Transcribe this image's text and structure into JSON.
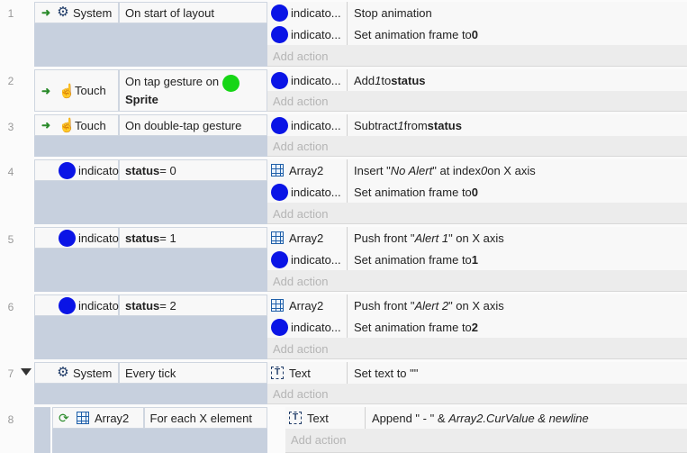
{
  "add_action_label": "Add action",
  "events": [
    {
      "number": "1",
      "condition": {
        "object": "System",
        "text": "On start of layout"
      },
      "actions": [
        {
          "object": "indicato...",
          "pre": "Stop animation",
          "em": "",
          "mid": "",
          "strong": ""
        },
        {
          "object": "indicato...",
          "pre": "Set animation frame to ",
          "em": "",
          "mid": "",
          "strong": "0"
        }
      ]
    },
    {
      "number": "2",
      "condition": {
        "object": "Touch",
        "text": "On tap gesture on",
        "text2": "Sprite"
      },
      "actions": [
        {
          "object": "indicato...",
          "pre": "Add ",
          "em": "1",
          "mid": " to ",
          "strong": "status"
        }
      ]
    },
    {
      "number": "3",
      "condition": {
        "object": "Touch",
        "text": "On double-tap gesture"
      },
      "actions": [
        {
          "object": "indicato...",
          "pre": "Subtract ",
          "em": "1",
          "mid": " from ",
          "strong": "status"
        }
      ]
    },
    {
      "number": "4",
      "condition": {
        "object": "indicator...",
        "strong": "status",
        "text": " = 0"
      },
      "actions": [
        {
          "object": "Array2",
          "pre": "Insert \"",
          "em": "No Alert",
          "mid": "\" at index ",
          "em2": "0",
          "post": " on X axis",
          "strong": ""
        },
        {
          "object": "indicato...",
          "pre": "Set animation frame to ",
          "em": "",
          "mid": "",
          "strong": "0"
        }
      ]
    },
    {
      "number": "5",
      "condition": {
        "object": "indicator...",
        "strong": "status",
        "text": " = 1"
      },
      "actions": [
        {
          "object": "Array2",
          "pre": "Push front \"",
          "em": "Alert 1",
          "mid": "\" on X axis",
          "strong": ""
        },
        {
          "object": "indicato...",
          "pre": "Set animation frame to ",
          "em": "",
          "mid": "",
          "strong": "1"
        }
      ]
    },
    {
      "number": "6",
      "condition": {
        "object": "indicator...",
        "strong": "status",
        "text": " = 2"
      },
      "actions": [
        {
          "object": "Array2",
          "pre": "Push front \"",
          "em": "Alert 2",
          "mid": "\" on X axis",
          "strong": ""
        },
        {
          "object": "indicato...",
          "pre": "Set animation frame to ",
          "em": "",
          "mid": "",
          "strong": "2"
        }
      ]
    },
    {
      "number": "7",
      "condition": {
        "object": "System",
        "text": "Every tick"
      },
      "actions": [
        {
          "object": "Text",
          "pre": "Set text to \"\"",
          "em": "",
          "mid": "",
          "strong": ""
        }
      ]
    },
    {
      "number": "8",
      "condition": {
        "object": "Array2",
        "text": "For each X element"
      },
      "actions": [
        {
          "object": "Text",
          "pre": "Append \" - \" & ",
          "em": "Array2.CurValue & newline",
          "mid": "",
          "strong": ""
        }
      ]
    }
  ],
  "colors": {
    "indicator": "#0a14e6",
    "sprite": "#16d616",
    "condition_zone": "#c7d0de"
  },
  "icons": [
    "trigger-arrow-icon",
    "gear-icon",
    "touch-hand-icon",
    "array-grid-icon",
    "text-object-icon",
    "loop-icon",
    "collapse-arrow-icon"
  ]
}
